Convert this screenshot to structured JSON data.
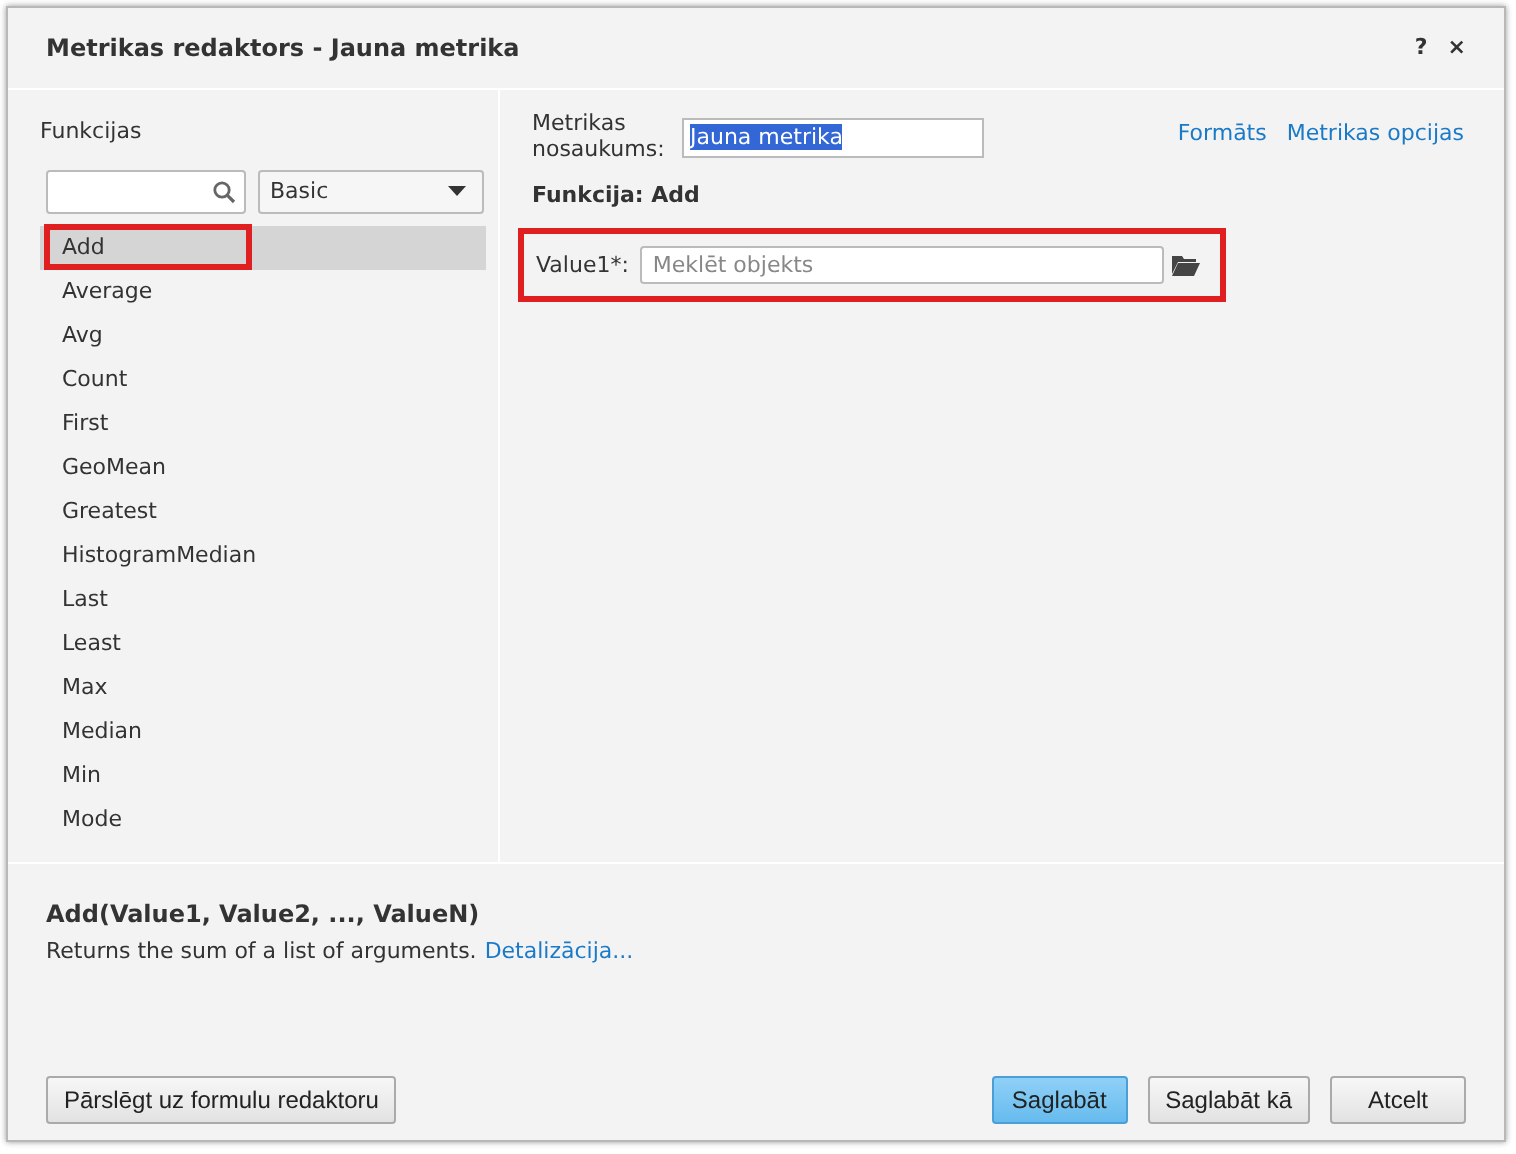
{
  "window": {
    "title": "Metrikas redaktors - Jauna metrika",
    "help": "?",
    "close": "×"
  },
  "functions": {
    "heading": "Funkcijas",
    "category": "Basic",
    "items": [
      {
        "label": "Add",
        "selected": true,
        "annotated": true
      },
      {
        "label": "Average",
        "selected": false,
        "annotated": false
      },
      {
        "label": "Avg",
        "selected": false,
        "annotated": false
      },
      {
        "label": "Count",
        "selected": false,
        "annotated": false
      },
      {
        "label": "First",
        "selected": false,
        "annotated": false
      },
      {
        "label": "GeoMean",
        "selected": false,
        "annotated": false
      },
      {
        "label": "Greatest",
        "selected": false,
        "annotated": false
      },
      {
        "label": "HistogramMedian",
        "selected": false,
        "annotated": false
      },
      {
        "label": "Last",
        "selected": false,
        "annotated": false
      },
      {
        "label": "Least",
        "selected": false,
        "annotated": false
      },
      {
        "label": "Max",
        "selected": false,
        "annotated": false
      },
      {
        "label": "Median",
        "selected": false,
        "annotated": false
      },
      {
        "label": "Min",
        "selected": false,
        "annotated": false
      },
      {
        "label": "Mode",
        "selected": false,
        "annotated": false
      }
    ]
  },
  "editor": {
    "name_label": "Metrikas nosaukums:",
    "name_value": "Jauna metrika",
    "links": [
      "Formāts",
      "Metrikas opcijas"
    ],
    "function_title": "Funkcija: Add",
    "params": [
      {
        "label": "Value1*:",
        "placeholder": "Meklēt objekts",
        "annotated": true
      }
    ]
  },
  "description": {
    "signature": "Add(Value1, Value2, ..., ValueN)",
    "text": "Returns the sum of a list of arguments.",
    "link": "Detalizācija..."
  },
  "footer": {
    "switch_button": "Pārslēgt uz formulu redaktoru",
    "buttons": [
      {
        "label": "Saglabāt",
        "primary": true
      },
      {
        "label": "Saglabāt kā",
        "primary": false
      },
      {
        "label": "Atcelt",
        "primary": false
      }
    ]
  }
}
